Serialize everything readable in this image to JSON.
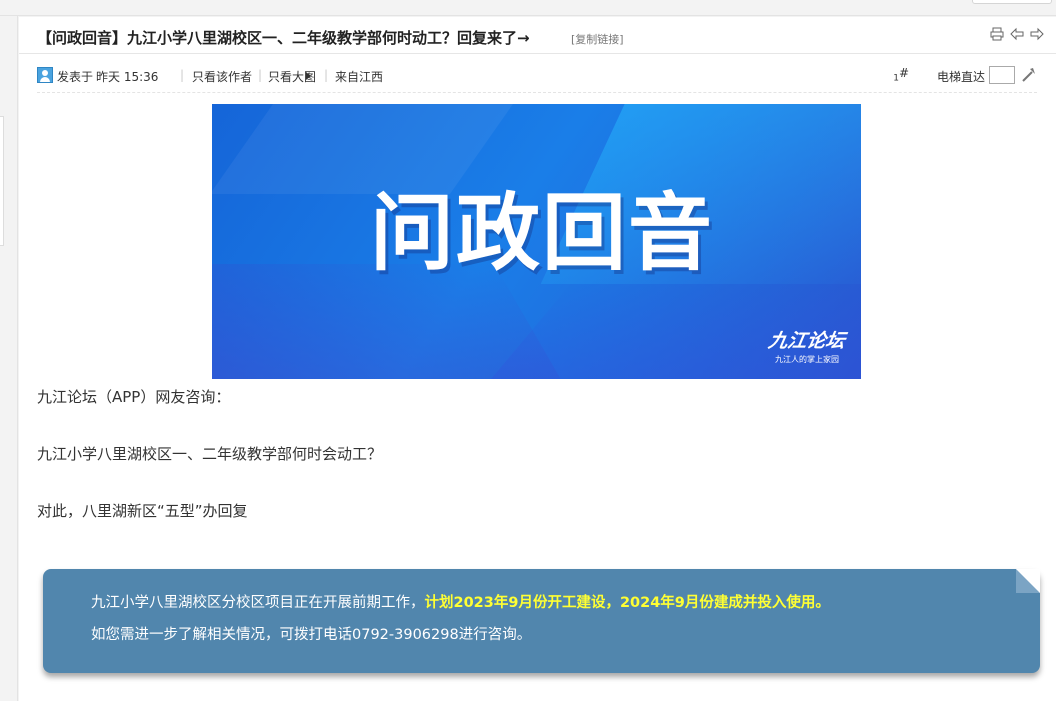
{
  "thread": {
    "title": "【问政回音】九江小学八里湖校区一、二年级教学部何时动工？回复来了→",
    "copy_link": "[复制链接]"
  },
  "meta": {
    "posted_prefix": "发表于",
    "posted_time": "昨天 15:36",
    "author_only": "只看该作者",
    "big_image": "只看大图",
    "from": "来自江西",
    "floor": "1",
    "floor_suffix": "#",
    "elevator_label": "电梯直达"
  },
  "banner": {
    "title": "问政回音",
    "logo_main": "九江论坛",
    "logo_sub": "九江人的掌上家园"
  },
  "body": {
    "p1": "九江论坛（APP）网友咨询：",
    "p2": "九江小学八里湖校区一、二年级教学部何时会动工？",
    "p3": "对此，八里湖新区“五型”办回复"
  },
  "note": {
    "line1_normal": "九江小学八里湖校区分校区项目正在开展前期工作，",
    "line1_highlight": "计划2023年9月份开工建设，2024年9月份建成并投入使用。",
    "line2": "如您需进一步了解相关情况，可拨打电话0792-3906298进行咨询。"
  },
  "colors": {
    "note_bg": "#5186ad",
    "highlight": "#ffff33",
    "banner_blue": "#1a7ee8"
  }
}
